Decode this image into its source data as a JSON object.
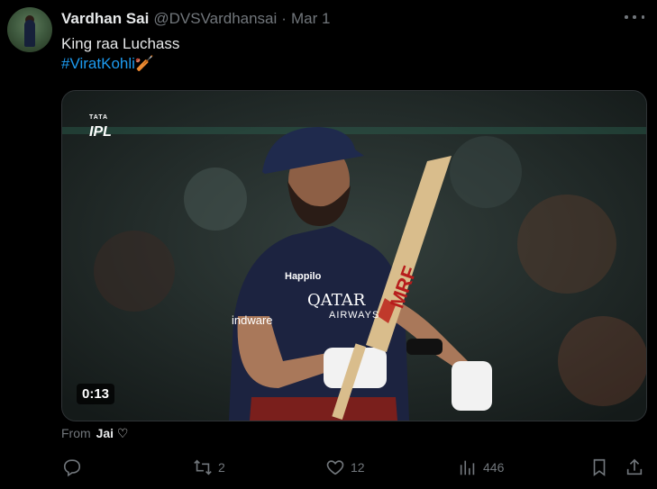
{
  "post": {
    "author_name": "Vardhan Sai",
    "handle": "@DVSVardhansai",
    "separator": "·",
    "date": "Mar 1",
    "text": "King raa Luchass",
    "hashtag": "#ViratKohli🏏"
  },
  "video": {
    "duration": "0:13",
    "logo_top": "TATA",
    "logo_text": "IPL",
    "jersey_sponsor_1": "QATAR",
    "jersey_sponsor_2": "AIRWAYS",
    "jersey_left_text": "indware",
    "jersey_chest_text": "Happilo",
    "bat_text": "MRF"
  },
  "attribution": {
    "prefix": "From",
    "name": "Jai ♡"
  },
  "actions": {
    "reply_count": "",
    "repost_count": "2",
    "like_count": "12",
    "views_count": "446"
  },
  "icons": {
    "more": "more-horizontal-icon",
    "reply": "reply-icon",
    "repost": "repost-icon",
    "like": "heart-icon",
    "views": "views-icon",
    "bookmark": "bookmark-icon",
    "share": "share-icon"
  },
  "colors": {
    "background": "#000000",
    "text_primary": "#e7e9ea",
    "text_secondary": "#71767b",
    "link": "#1d9bf0"
  }
}
